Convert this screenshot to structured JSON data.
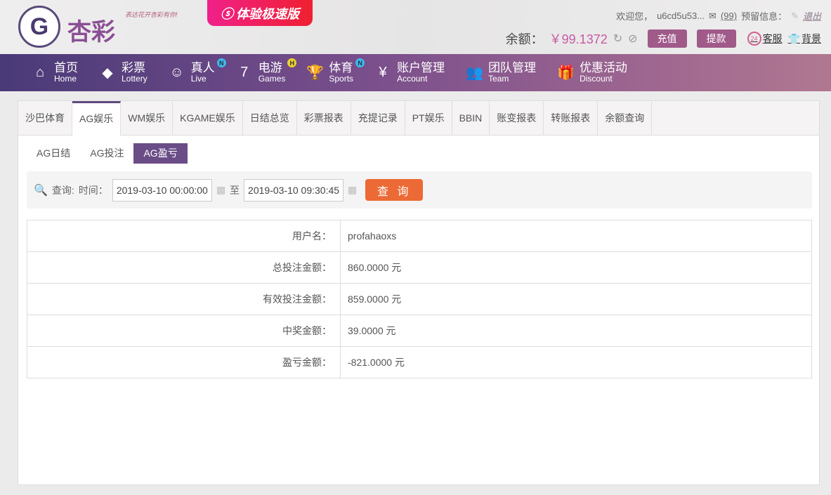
{
  "header": {
    "brand": "杏彩",
    "slogan": "表达花开杏彩有你!",
    "speed_label": "体验极速版",
    "welcome": "欢迎您，",
    "username": "u6cd5u53...",
    "msg_count": "(99)",
    "reserved_info": "预留信息：",
    "logout": "退出",
    "balance_label": "余额：",
    "balance": "￥99.1372",
    "deposit": "充值",
    "withdraw": "提款",
    "service": "客服",
    "background": "背景"
  },
  "nav": [
    {
      "cn": "首页",
      "en": "Home",
      "icon": "⌂"
    },
    {
      "cn": "彩票",
      "en": "Lottery",
      "icon": "◆"
    },
    {
      "cn": "真人",
      "en": "Live",
      "icon": "☺",
      "badge": "N"
    },
    {
      "cn": "电游",
      "en": "Games",
      "icon": "7",
      "badge": "H"
    },
    {
      "cn": "体育",
      "en": "Sports",
      "icon": "🏆",
      "badge": "N"
    },
    {
      "cn": "账户管理",
      "en": "Account",
      "icon": "¥"
    },
    {
      "cn": "团队管理",
      "en": "Team",
      "icon": "👥"
    },
    {
      "cn": "优惠活动",
      "en": "Discount",
      "icon": "🎁"
    }
  ],
  "tabs": [
    "沙巴体育",
    "AG娱乐",
    "WM娱乐",
    "KGAME娱乐",
    "日结总览",
    "彩票报表",
    "充提记录",
    "PT娱乐",
    "BBIN",
    "账变报表",
    "转账报表",
    "余额查询"
  ],
  "subtabs": [
    "AG日结",
    "AG投注",
    "AG盈亏"
  ],
  "search": {
    "query_label": "查询:",
    "time_label": "时间：",
    "start": "2019-03-10 00:00:00",
    "to": "至",
    "end": "2019-03-10 09:30:45",
    "button": "查 询"
  },
  "rows": [
    {
      "label": "用户名：",
      "value": "profahaoxs"
    },
    {
      "label": "总投注金额：",
      "value": "860.0000 元"
    },
    {
      "label": "有效投注金额：",
      "value": "859.0000 元"
    },
    {
      "label": "中奖金额：",
      "value": "39.0000 元"
    },
    {
      "label": "盈亏金额：",
      "value": "-821.0000 元"
    }
  ]
}
